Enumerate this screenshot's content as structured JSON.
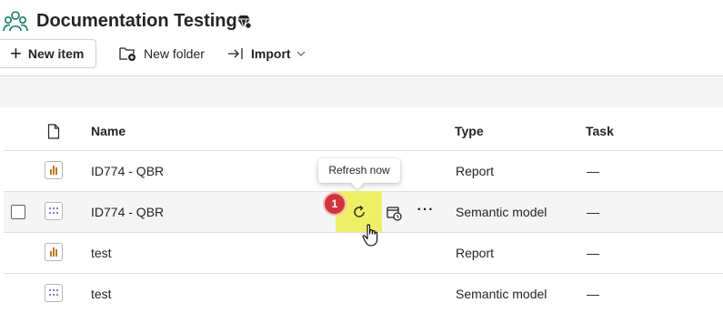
{
  "workspace": {
    "icon": "workspace-people-icon",
    "title": "Documentation Testing",
    "badge_icon": "premium-diamond-icon"
  },
  "toolbar": {
    "new_item_label": "New item",
    "new_folder_label": "New folder",
    "import_label": "Import"
  },
  "table": {
    "columns": {
      "type_icon": "document-icon",
      "name": "Name",
      "type": "Type",
      "task": "Task"
    },
    "rows": [
      {
        "name": "ID774 - QBR",
        "type": "Report",
        "task": "—",
        "icon": "report-bar-chart-icon"
      },
      {
        "name": "ID774 - QBR",
        "type": "Semantic model",
        "task": "—",
        "icon": "semantic-model-grid-icon"
      },
      {
        "name": "test",
        "type": "Report",
        "task": "—",
        "icon": "report-bar-chart-icon"
      },
      {
        "name": "test",
        "type": "Semantic model",
        "task": "—",
        "icon": "semantic-model-grid-icon"
      }
    ]
  },
  "actions": {
    "tooltip": "Refresh now",
    "step_number": "1",
    "more_label": "···"
  },
  "colors": {
    "highlight": "#eeee55",
    "step_badge": "#d13438",
    "report_icon": "#c07a1a",
    "semantic_icon": "#6b4fb0",
    "workspace_icon": "#0f7b6c"
  }
}
